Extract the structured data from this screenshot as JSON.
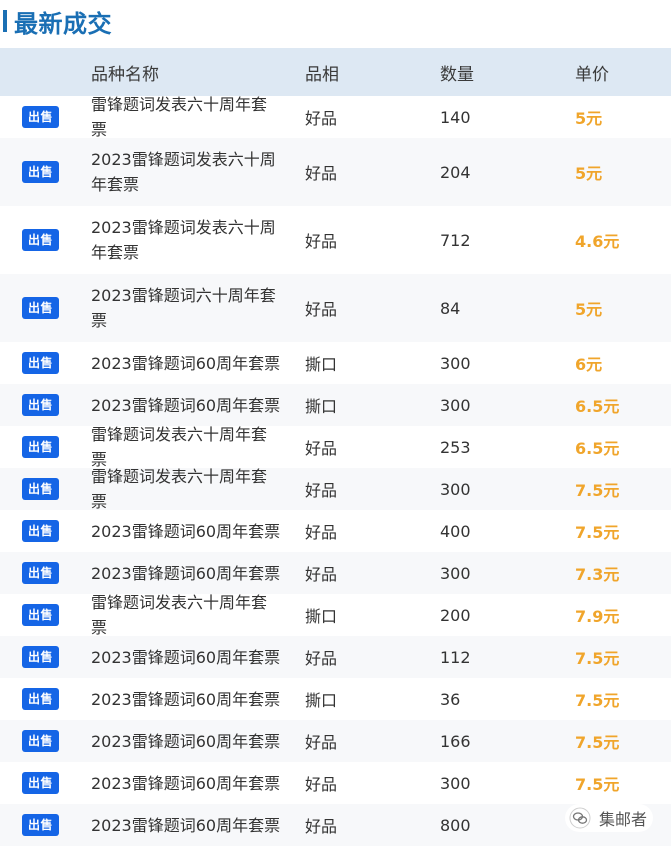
{
  "title": "最新成交",
  "colors": {
    "accent": "#1a6fb4",
    "header_bg": "#dde8f3",
    "badge_bg": "#1565e6",
    "price": "#f0a52b",
    "stripe": "#f7f8fa"
  },
  "table": {
    "headers": [
      "",
      "品种名称",
      "品相",
      "数量",
      "单价"
    ],
    "rows": [
      {
        "type": "出售",
        "name": "雷锋题词发表六十周年套票",
        "condition": "好品",
        "qty": "140",
        "price": "5元"
      },
      {
        "type": "出售",
        "name": "2023雷锋题词发表六十周年套票",
        "condition": "好品",
        "qty": "204",
        "price": "5元"
      },
      {
        "type": "出售",
        "name": "2023雷锋题词发表六十周年套票",
        "condition": "好品",
        "qty": "712",
        "price": "4.6元"
      },
      {
        "type": "出售",
        "name": "2023雷锋题词六十周年套票",
        "condition": "好品",
        "qty": "84",
        "price": "5元"
      },
      {
        "type": "出售",
        "name": "2023雷锋题词60周年套票",
        "condition": "撕口",
        "qty": "300",
        "price": "6元"
      },
      {
        "type": "出售",
        "name": "2023雷锋题词60周年套票",
        "condition": "撕口",
        "qty": "300",
        "price": "6.5元"
      },
      {
        "type": "出售",
        "name": "雷锋题词发表六十周年套票",
        "condition": "好品",
        "qty": "253",
        "price": "6.5元"
      },
      {
        "type": "出售",
        "name": "雷锋题词发表六十周年套票",
        "condition": "好品",
        "qty": "300",
        "price": "7.5元"
      },
      {
        "type": "出售",
        "name": "2023雷锋题词60周年套票",
        "condition": "好品",
        "qty": "400",
        "price": "7.5元"
      },
      {
        "type": "出售",
        "name": "2023雷锋题词60周年套票",
        "condition": "好品",
        "qty": "300",
        "price": "7.3元"
      },
      {
        "type": "出售",
        "name": "雷锋题词发表六十周年套票",
        "condition": "撕口",
        "qty": "200",
        "price": "7.9元"
      },
      {
        "type": "出售",
        "name": "2023雷锋题词60周年套票",
        "condition": "好品",
        "qty": "112",
        "price": "7.5元"
      },
      {
        "type": "出售",
        "name": "2023雷锋题词60周年套票",
        "condition": "撕口",
        "qty": "36",
        "price": "7.5元"
      },
      {
        "type": "出售",
        "name": "2023雷锋题词60周年套票",
        "condition": "好品",
        "qty": "166",
        "price": "7.5元"
      },
      {
        "type": "出售",
        "name": "2023雷锋题词60周年套票",
        "condition": "好品",
        "qty": "300",
        "price": "7.5元"
      },
      {
        "type": "出售",
        "name": "2023雷锋题词60周年套票",
        "condition": "好品",
        "qty": "800",
        "price": ""
      }
    ]
  },
  "watermark": {
    "icon": "wechat-icon",
    "text": "集邮者"
  }
}
